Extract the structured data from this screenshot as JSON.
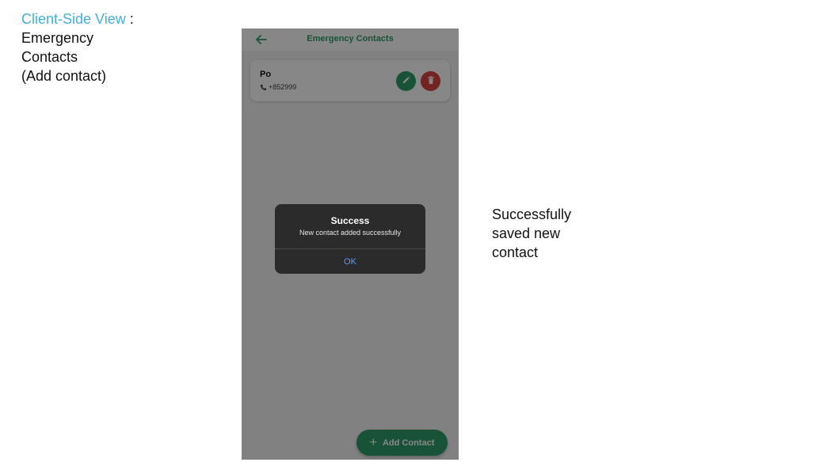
{
  "caption": {
    "accent_text": "Client-Side View",
    "separator": " :",
    "lines": [
      "Emergency",
      "Contacts",
      "(Add contact)"
    ]
  },
  "note": {
    "lines": [
      "Successfully",
      "saved new",
      "contact"
    ]
  },
  "app": {
    "screen_title": "Emergency Contacts",
    "back_icon": "arrow-left-icon",
    "contacts": [
      {
        "name": "Po",
        "phone": "+852999",
        "phone_icon": "phone-icon",
        "edit_icon": "pencil-icon",
        "delete_icon": "trash-icon"
      }
    ],
    "fab": {
      "icon": "plus-icon",
      "plus_glyph": "+",
      "label": "Add Contact"
    }
  },
  "alert": {
    "title": "Success",
    "message": "New contact added successfully",
    "ok_label": "OK"
  },
  "colors": {
    "accent_caption": "#45b0d6",
    "primary_green": "#2e9e6a",
    "delete_red": "#d9433f",
    "alert_bg": "#2b2b2b",
    "alert_ok": "#5b9bf2",
    "overlay": "rgba(0,0,0,0.47)"
  }
}
